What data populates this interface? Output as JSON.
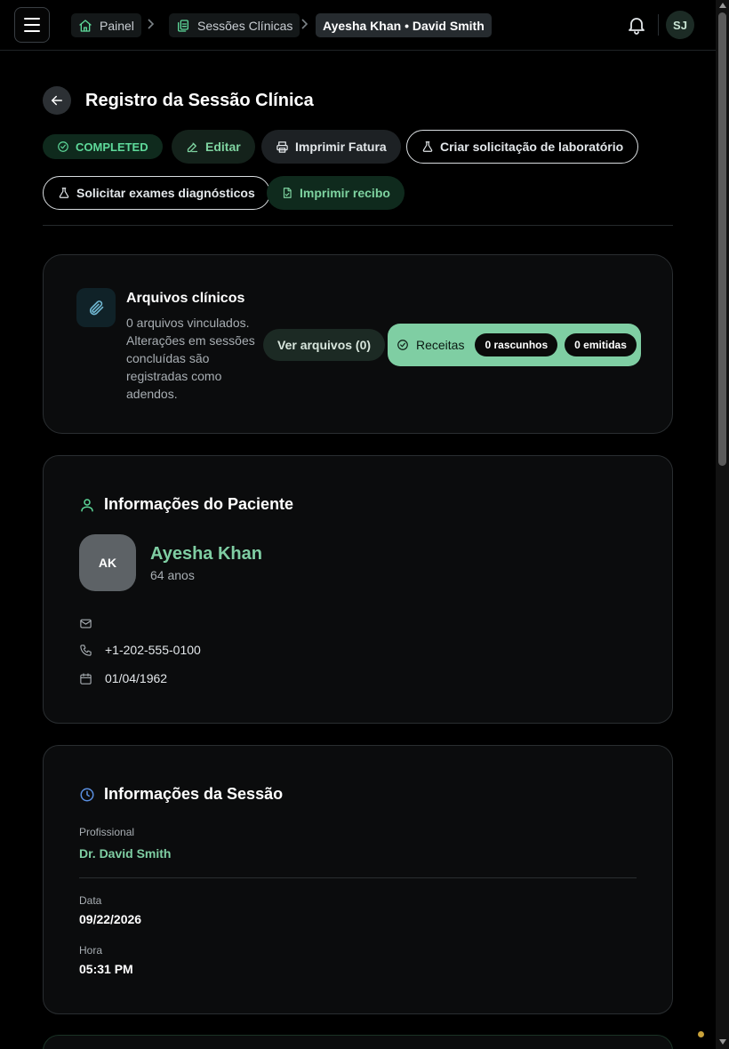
{
  "topbar": {
    "breadcrumbs": [
      {
        "label": "Painel"
      },
      {
        "label": "Sessões Clínicas"
      },
      {
        "label": "Ayesha Khan • David Smith"
      }
    ],
    "user_initials": "SJ"
  },
  "header": {
    "title": "Registro da Sessão Clínica",
    "status": "COMPLETED",
    "actions": {
      "edit": "Editar",
      "print_invoice": "Imprimir Fatura",
      "create_lab": "Criar solicitação de laboratório",
      "request_diag": "Solicitar exames diagnósticos",
      "print_receipt": "Imprimir recibo"
    }
  },
  "files": {
    "title": "Arquivos clínicos",
    "description": "0 arquivos vinculados. Alterações em sessões concluídas são registradas como adendos.",
    "view_button": "Ver arquivos (0)",
    "prescriptions": {
      "label": "Receitas",
      "drafts": "0 rascunhos",
      "issued": "0 emitidas"
    }
  },
  "patient": {
    "section_title": "Informações do Paciente",
    "initials": "AK",
    "name": "Ayesha Khan",
    "age": "64 anos",
    "email": "",
    "phone": "+1-202-555-0100",
    "birthdate": "01/04/1962"
  },
  "session": {
    "section_title": "Informações da Sessão",
    "professional_label": "Profissional",
    "professional": "Dr. David Smith",
    "date_label": "Data",
    "date": "09/22/2026",
    "time_label": "Hora",
    "time": "05:31 PM"
  },
  "colors": {
    "accent": "#7fcea3",
    "status_green": "#5ed99a",
    "background": "#000000",
    "card": "#0b0c0d"
  },
  "icons": [
    "menu-icon",
    "home-icon",
    "clipboard-icon",
    "chevron-right-icon",
    "bell-icon",
    "arrow-left-icon",
    "check-circle-icon",
    "edit-icon",
    "printer-icon",
    "flask-icon",
    "file-icon",
    "paperclip-icon",
    "user-icon",
    "mail-icon",
    "phone-icon",
    "calendar-icon",
    "clock-icon"
  ]
}
